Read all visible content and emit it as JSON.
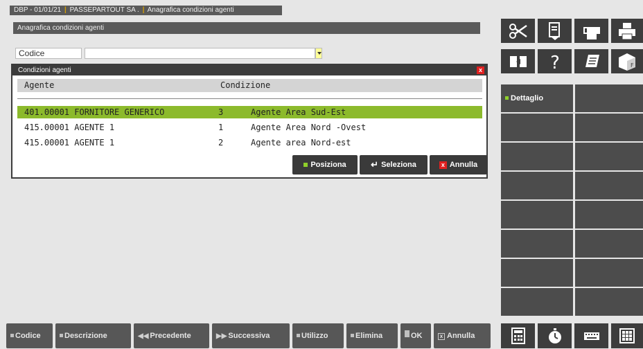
{
  "title_bar": {
    "db": "DBP - 01/01/21",
    "company": "PASSEPARTOUT SA .",
    "module": "Anagrafica condizioni agenti"
  },
  "subheader": "Anagrafica condizioni agenti",
  "codice": {
    "label": "Codice",
    "value": ""
  },
  "dialog": {
    "title": "Condizioni agenti",
    "close": "x",
    "columns": [
      "Agente",
      "Condizione"
    ],
    "rows": [
      {
        "agente": "401.00001 FORNITORE GENERICO",
        "num": "3",
        "condizione": "Agente Area Sud-Est",
        "selected": true
      },
      {
        "agente": "415.00001 AGENTE 1",
        "num": "1",
        "condizione": "Agente Area Nord -Ovest",
        "selected": false
      },
      {
        "agente": "415.00001 AGENTE 1",
        "num": "2",
        "condizione": "Agente area Nord-est",
        "selected": false
      }
    ],
    "buttons": {
      "posiziona": "Posiziona",
      "seleziona": "Seleziona",
      "annulla": "Annulla"
    }
  },
  "right_panel": {
    "icons": [
      "scissors-icon",
      "paste-icon",
      "eraser-icon",
      "print-icon",
      "export-icon",
      "help-icon",
      "notes-icon",
      "dice-icon"
    ],
    "dettaglio": "Dettaglio"
  },
  "bottom_bar": {
    "codice": "Codice",
    "descrizione": "Descrizione",
    "precedente": "Precedente",
    "successiva": "Successiva",
    "utilizzo": "Utilizzo",
    "elimina": "Elimina",
    "ok": "OK",
    "annulla": "Annulla",
    "icons": [
      "calculator-icon",
      "stopwatch-icon",
      "keyboard-icon",
      "grid-menu-icon"
    ]
  },
  "colors": {
    "selected_row": "#8cba2c",
    "accent_green": "#8fd02a",
    "close_red": "#e02020",
    "dark_panel": "#3d3d3d"
  }
}
